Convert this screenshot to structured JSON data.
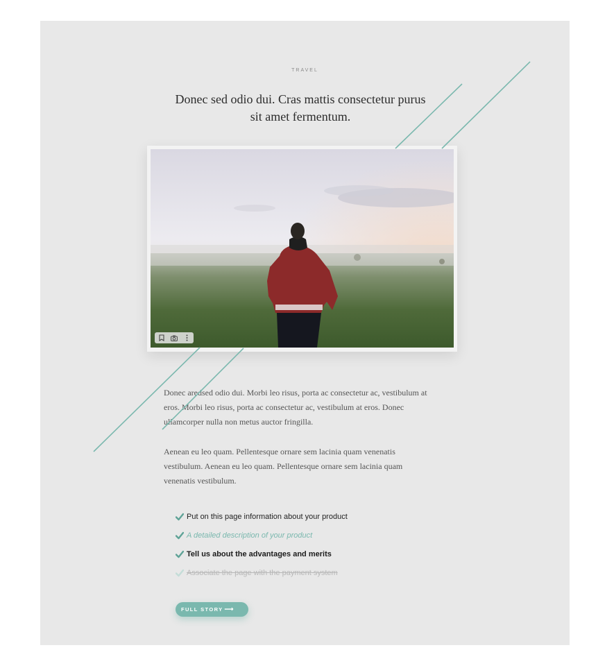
{
  "post": {
    "category": "TRAVEL",
    "headline": "Donec sed odio dui. Cras mattis consectetur purus sit amet fermentum.",
    "paragraph_1": "Donec aredsed odio dui. Morbi leo risus, porta ac consectetur ac, vestibulum at eros. Morbi leo risus, porta ac consectetur ac, vestibulum at eros. Donec ullamcorper nulla non metus auctor fringilla.",
    "paragraph_2": "Aenean eu leo quam. Pellentesque ornare sem lacinia quam venenatis vestibulum. Aenean eu leo quam. Pellentesque ornare sem lacinia quam venenatis vestibulum."
  },
  "photo_toolbar": {
    "icons": [
      "bookmark-icon",
      "camera-icon",
      "more-vertical-icon"
    ]
  },
  "checklist": [
    {
      "label": "Put on this page information about your product",
      "style": "normal"
    },
    {
      "label": "A detailed description of your product",
      "style": "italic-accent"
    },
    {
      "label": "Tell us about the advantages and merits",
      "style": "bold"
    },
    {
      "label": "Associate the page with the payment system",
      "style": "struck"
    }
  ],
  "cta": {
    "label": "FULL STORY",
    "arrow": "⟶"
  },
  "colors": {
    "accent": "#7ab8ae",
    "page_bg": "#e8e8e8",
    "text": "#555555",
    "heading": "#2b2b2b"
  }
}
